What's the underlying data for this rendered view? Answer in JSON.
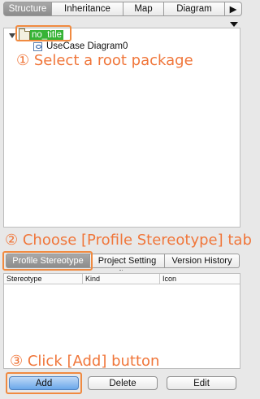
{
  "top_tabs": [
    {
      "label": "Structure",
      "active": true
    },
    {
      "label": "Inheritance",
      "active": false
    },
    {
      "label": "Map",
      "active": false
    },
    {
      "label": "Diagram",
      "active": false
    }
  ],
  "more_tabs_icon": "▶",
  "tree": {
    "root_label": "no_title",
    "child_label": "UseCase Diagram0"
  },
  "callouts": {
    "step1": "① Select a root package",
    "step2": "② Choose [Profile Stereotype] tab",
    "step3": "③ Click [Add] button"
  },
  "bottom_tabs": [
    {
      "label": "Profile Stereotype",
      "active": true
    },
    {
      "label": "Project Setting",
      "active": false
    },
    {
      "label": "Version History",
      "active": false
    }
  ],
  "table": {
    "columns": [
      "Stereotype",
      "Kind",
      "Icon"
    ]
  },
  "buttons": {
    "add": "Add",
    "delete": "Delete",
    "edit": "Edit"
  },
  "colors": {
    "callout": "#f0763a",
    "highlight_border": "#f08a40",
    "selected_node": "#36b336",
    "primary_button": "#6aa7ea"
  }
}
